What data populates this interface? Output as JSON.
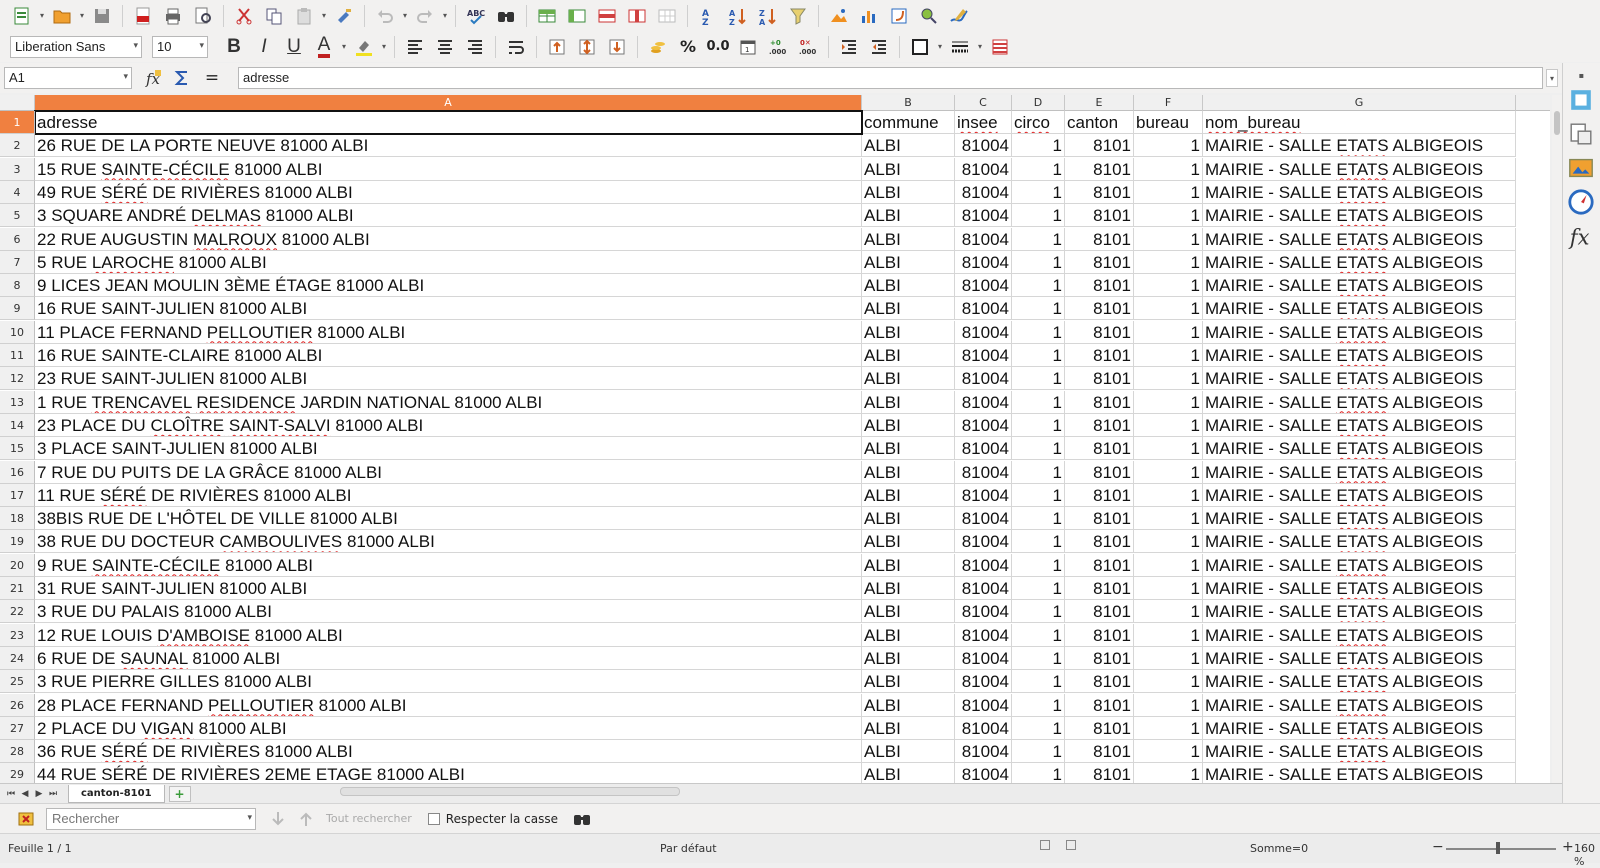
{
  "toolbar": {
    "font_name": "Liberation Sans",
    "font_size": "10",
    "bold": "B",
    "italic": "I",
    "underline": "U",
    "font_color": "A",
    "percent": "%",
    "decimal": "0.0",
    "add_decimal": "+0\n.000",
    "del_decimal": ".000"
  },
  "formula_bar": {
    "cell_ref": "A1",
    "equals": "=",
    "value": "adresse"
  },
  "columns": [
    "A",
    "B",
    "C",
    "D",
    "E",
    "F",
    "G"
  ],
  "headers": [
    "adresse",
    "commune",
    "insee",
    "circo",
    "canton",
    "bureau",
    "nom_bureau"
  ],
  "row_numbers": [
    "1",
    "2",
    "3",
    "4",
    "5",
    "6",
    "7",
    "8",
    "9",
    "10",
    "11",
    "12",
    "13",
    "14",
    "15",
    "16",
    "17",
    "18",
    "19",
    "20",
    "21",
    "22",
    "23",
    "24",
    "25",
    "26",
    "27",
    "28",
    "29"
  ],
  "rows": [
    [
      "26  RUE DE LA PORTE NEUVE  81000 ALBI",
      "ALBI",
      "81004",
      "1",
      "8101",
      "1",
      "MAIRIE - SALLE ETATS ALBIGEOIS"
    ],
    [
      "15  RUE SAINTE-CÉCILE  81000 ALBI",
      "ALBI",
      "81004",
      "1",
      "8101",
      "1",
      "MAIRIE - SALLE ETATS ALBIGEOIS"
    ],
    [
      "49  RUE SÉRÉ DE RIVIÈRES  81000 ALBI",
      "ALBI",
      "81004",
      "1",
      "8101",
      "1",
      "MAIRIE - SALLE ETATS ALBIGEOIS"
    ],
    [
      "3  SQUARE ANDRÉ DELMAS  81000 ALBI",
      "ALBI",
      "81004",
      "1",
      "8101",
      "1",
      "MAIRIE - SALLE ETATS ALBIGEOIS"
    ],
    [
      "22  RUE AUGUSTIN MALROUX  81000 ALBI",
      "ALBI",
      "81004",
      "1",
      "8101",
      "1",
      "MAIRIE - SALLE ETATS ALBIGEOIS"
    ],
    [
      "5  RUE LAROCHE  81000 ALBI",
      "ALBI",
      "81004",
      "1",
      "8101",
      "1",
      "MAIRIE - SALLE ETATS ALBIGEOIS"
    ],
    [
      "9  LICES JEAN MOULIN 3ÈME ÉTAGE 81000 ALBI",
      "ALBI",
      "81004",
      "1",
      "8101",
      "1",
      "MAIRIE - SALLE ETATS ALBIGEOIS"
    ],
    [
      "16  RUE SAINT-JULIEN  81000 ALBI",
      "ALBI",
      "81004",
      "1",
      "8101",
      "1",
      "MAIRIE - SALLE ETATS ALBIGEOIS"
    ],
    [
      "11  PLACE FERNAND PELLOUTIER  81000 ALBI",
      "ALBI",
      "81004",
      "1",
      "8101",
      "1",
      "MAIRIE - SALLE ETATS ALBIGEOIS"
    ],
    [
      "16  RUE SAINTE-CLAIRE  81000 ALBI",
      "ALBI",
      "81004",
      "1",
      "8101",
      "1",
      "MAIRIE - SALLE ETATS ALBIGEOIS"
    ],
    [
      "23  RUE SAINT-JULIEN  81000 ALBI",
      "ALBI",
      "81004",
      "1",
      "8101",
      "1",
      "MAIRIE - SALLE ETATS ALBIGEOIS"
    ],
    [
      "1  RUE TRENCAVEL RESIDENCE JARDIN NATIONAL 81000 ALBI",
      "ALBI",
      "81004",
      "1",
      "8101",
      "1",
      "MAIRIE - SALLE ETATS ALBIGEOIS"
    ],
    [
      "23  PLACE DU CLOÎTRE SAINT-SALVI  81000 ALBI",
      "ALBI",
      "81004",
      "1",
      "8101",
      "1",
      "MAIRIE - SALLE ETATS ALBIGEOIS"
    ],
    [
      "3  PLACE SAINT-JULIEN  81000 ALBI",
      "ALBI",
      "81004",
      "1",
      "8101",
      "1",
      "MAIRIE - SALLE ETATS ALBIGEOIS"
    ],
    [
      "7  RUE DU PUITS DE LA GRÂCE  81000 ALBI",
      "ALBI",
      "81004",
      "1",
      "8101",
      "1",
      "MAIRIE - SALLE ETATS ALBIGEOIS"
    ],
    [
      "11  RUE SÉRÉ DE RIVIÈRES  81000 ALBI",
      "ALBI",
      "81004",
      "1",
      "8101",
      "1",
      "MAIRIE - SALLE ETATS ALBIGEOIS"
    ],
    [
      "38BIS  RUE DE L'HÔTEL DE VILLE  81000 ALBI",
      "ALBI",
      "81004",
      "1",
      "8101",
      "1",
      "MAIRIE - SALLE ETATS ALBIGEOIS"
    ],
    [
      "38  RUE DU DOCTEUR CAMBOULIVES  81000 ALBI",
      "ALBI",
      "81004",
      "1",
      "8101",
      "1",
      "MAIRIE - SALLE ETATS ALBIGEOIS"
    ],
    [
      "9  RUE SAINTE-CÉCILE  81000 ALBI",
      "ALBI",
      "81004",
      "1",
      "8101",
      "1",
      "MAIRIE - SALLE ETATS ALBIGEOIS"
    ],
    [
      "31  RUE SAINT-JULIEN  81000 ALBI",
      "ALBI",
      "81004",
      "1",
      "8101",
      "1",
      "MAIRIE - SALLE ETATS ALBIGEOIS"
    ],
    [
      "3  RUE DU PALAIS  81000 ALBI",
      "ALBI",
      "81004",
      "1",
      "8101",
      "1",
      "MAIRIE - SALLE ETATS ALBIGEOIS"
    ],
    [
      "12  RUE LOUIS D'AMBOISE  81000 ALBI",
      "ALBI",
      "81004",
      "1",
      "8101",
      "1",
      "MAIRIE - SALLE ETATS ALBIGEOIS"
    ],
    [
      "6  RUE DE SAUNAL  81000 ALBI",
      "ALBI",
      "81004",
      "1",
      "8101",
      "1",
      "MAIRIE - SALLE ETATS ALBIGEOIS"
    ],
    [
      "3  RUE PIERRE GILLES  81000 ALBI",
      "ALBI",
      "81004",
      "1",
      "8101",
      "1",
      "MAIRIE - SALLE ETATS ALBIGEOIS"
    ],
    [
      "28  PLACE FERNAND PELLOUTIER  81000 ALBI",
      "ALBI",
      "81004",
      "1",
      "8101",
      "1",
      "MAIRIE - SALLE ETATS ALBIGEOIS"
    ],
    [
      "2  PLACE DU VIGAN  81000 ALBI",
      "ALBI",
      "81004",
      "1",
      "8101",
      "1",
      "MAIRIE - SALLE ETATS ALBIGEOIS"
    ],
    [
      "36  RUE SÉRÉ DE RIVIÈRES  81000 ALBI",
      "ALBI",
      "81004",
      "1",
      "8101",
      "1",
      "MAIRIE - SALLE ETATS ALBIGEOIS"
    ],
    [
      "44  RUE SÉRÉ DE RIVIÈRES 2EME ETAGE 81000 ALBI",
      "ALBI",
      "81004",
      "1",
      "8101",
      "1",
      "MAIRIE - SALLE ETATS ALBIGEOIS"
    ]
  ],
  "sheet_tab": "canton-8101",
  "findbar": {
    "search_placeholder": "Rechercher",
    "find_all": "Tout rechercher",
    "match_case": "Respecter la casse"
  },
  "statusbar": {
    "sheet_info": "Feuille 1 / 1",
    "page_style": "Par défaut",
    "sum": "Somme=0",
    "zoom_minus": "−",
    "zoom_plus": "+",
    "zoom": "160 %"
  },
  "colors": {
    "active_header": "#f08040",
    "spell_underline": "#e02020"
  }
}
